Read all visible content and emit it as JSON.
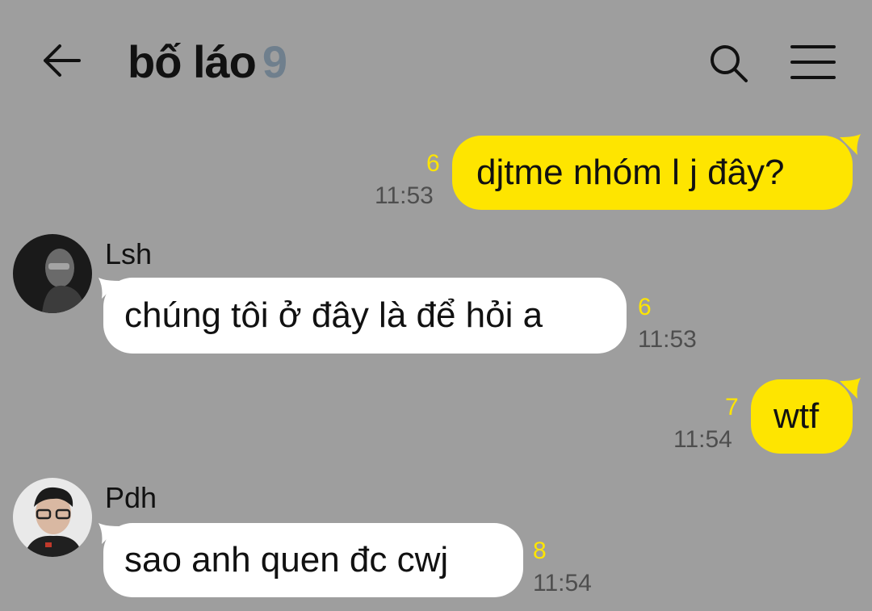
{
  "header": {
    "back_icon": "arrow-left-icon",
    "title": "bố láo",
    "member_count": "9",
    "search_icon": "search-icon",
    "menu_icon": "hamburger-menu-icon"
  },
  "colors": {
    "background": "#9e9e9e",
    "my_bubble": "#fee500",
    "other_bubble": "#ffffff",
    "unread_count": "#fee500",
    "member_count": "#6f7f8d"
  },
  "messages": [
    {
      "from": "me",
      "text": "djtme nhóm l j đây?",
      "unread": "6",
      "time": "11:53"
    },
    {
      "from": "other",
      "sender": "Lsh",
      "avatar_icon": "avatar-photo",
      "text": "chúng tôi ở đây là để hỏi a",
      "unread": "6",
      "time": "11:53"
    },
    {
      "from": "me",
      "text": "wtf",
      "unread": "7",
      "time": "11:54"
    },
    {
      "from": "other",
      "sender": "Pdh",
      "avatar_icon": "avatar-photo",
      "text": "sao anh quen đc cwj",
      "unread": "8",
      "time": "11:54"
    }
  ]
}
